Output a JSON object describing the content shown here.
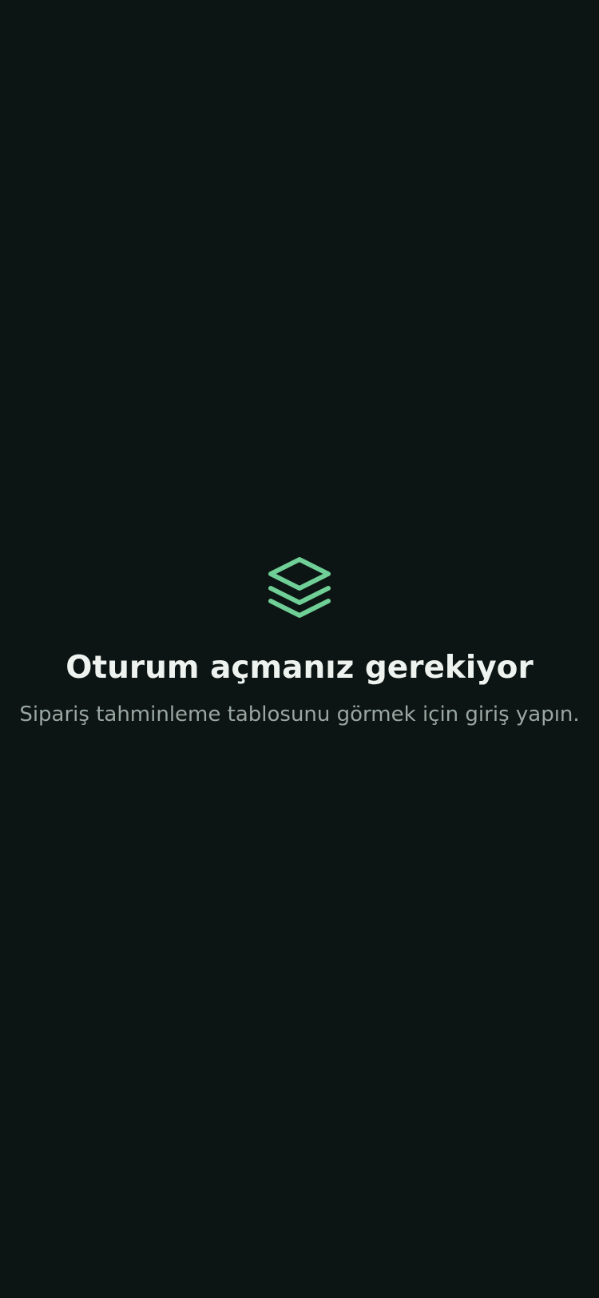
{
  "empty_state": {
    "icon": "stack-layers-icon",
    "icon_color": "#6fcf97",
    "title": "Oturum açmanız gerekiyor",
    "subtitle": "Sipariş tahminleme tablosunu görmek için giriş yapın."
  },
  "colors": {
    "background": "#0c1513",
    "title": "#eef3f0",
    "subtitle": "#9aa6a1",
    "accent": "#6fcf97"
  }
}
